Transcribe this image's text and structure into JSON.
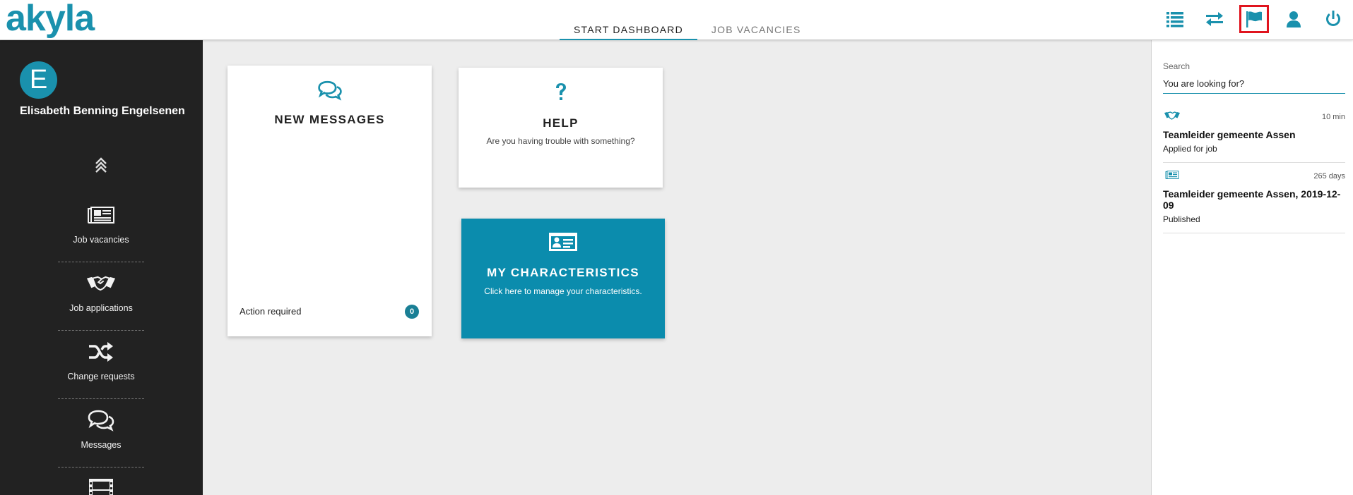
{
  "app": {
    "logo": "akyla"
  },
  "header": {
    "tabs": [
      {
        "label": "START DASHBOARD",
        "active": true
      },
      {
        "label": "JOB VACANCIES",
        "active": false
      }
    ],
    "icons": [
      "list-icon",
      "swap-icon",
      "flag-icon",
      "user-icon",
      "power-icon"
    ]
  },
  "sidebar": {
    "avatar_letter": "E",
    "user_name": "Elisabeth Benning Engelsenen",
    "items": [
      {
        "label": "Job vacancies",
        "icon": "newspaper-icon"
      },
      {
        "label": "Job applications",
        "icon": "handshake-icon"
      },
      {
        "label": "Change requests",
        "icon": "shuffle-icon"
      },
      {
        "label": "Messages",
        "icon": "chat-icon"
      },
      {
        "label": "",
        "icon": "film-icon"
      }
    ]
  },
  "cards": {
    "messages": {
      "title": "NEW MESSAGES",
      "action_label": "Action required",
      "count": "0"
    },
    "help": {
      "title": "HELP",
      "subtitle": "Are you having trouble with something?"
    },
    "characteristics": {
      "title": "MY CHARACTERISTICS",
      "subtitle": "Click here to manage your characteristics."
    }
  },
  "rightpanel": {
    "search_label": "Search",
    "search_placeholder": "You are looking for?",
    "feed": [
      {
        "icon": "handshake-icon",
        "time": "10 min",
        "title": "Teamleider gemeente Assen",
        "status": "Applied for job"
      },
      {
        "icon": "newspaper-icon",
        "time": "265 days",
        "title": "Teamleider gemeente Assen, 2019-12-09",
        "status": "Published"
      }
    ]
  },
  "colors": {
    "accent": "#1a91ad",
    "sidebar": "#222222",
    "highlight": "#e0141e"
  }
}
